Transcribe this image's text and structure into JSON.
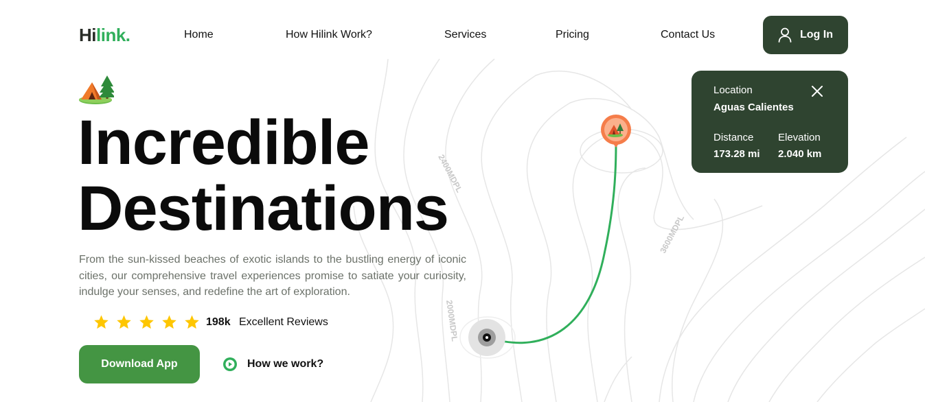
{
  "logo": {
    "part1": "Hi",
    "part2": "link."
  },
  "nav": {
    "home": "Home",
    "how": "How Hilink Work?",
    "services": "Services",
    "pricing": "Pricing",
    "contact": "Contact Us"
  },
  "login": {
    "label": "Log In",
    "icon": "user-icon"
  },
  "location_card": {
    "location_label": "Location",
    "location_value": "Aguas Calientes",
    "distance_label": "Distance",
    "distance_value": "173.28 mi",
    "elevation_label": "Elevation",
    "elevation_value": "2.040 km",
    "close_icon": "close-icon"
  },
  "hero": {
    "title_line1": "Incredible",
    "title_line2": "Destinations",
    "description": "From the sun-kissed beaches of exotic islands to the bustling energy of iconic cities, our comprehensive travel experiences promise to satiate your curiosity, indulge your senses, and redefine the art of exploration.",
    "rating_stars": 5,
    "reviews_count": "198k",
    "reviews_label": "Excellent Reviews",
    "download_label": "Download App",
    "how_label": "How we work?"
  },
  "map": {
    "labels": [
      "2400MDPL",
      "3600MDPL",
      "2000MDPL"
    ],
    "pin_icon": "camp-tent-icon",
    "start_icon": "start-point-icon"
  },
  "colors": {
    "dark_green": "#2f4430",
    "brand_green": "#30af5b",
    "button_green": "#449543",
    "star": "#fec601",
    "route": "#30af5b",
    "pin": "#f57d4a"
  }
}
